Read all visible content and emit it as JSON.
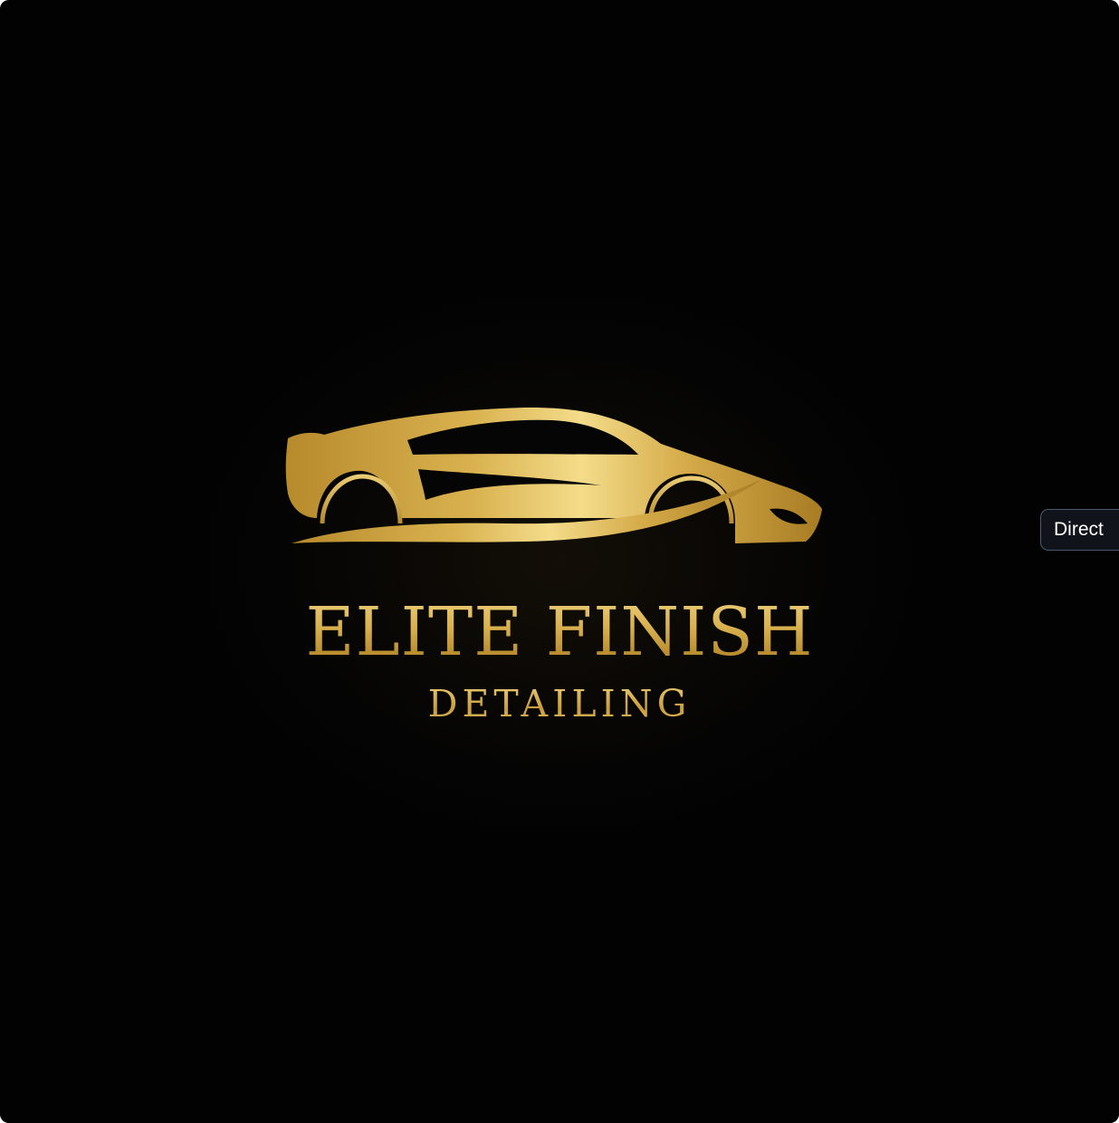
{
  "logo": {
    "brand_name": "ELITE FINISH",
    "brand_sub": "DETAILING",
    "icon": "sports-car-icon",
    "colors": {
      "background": "#050505",
      "gold_light": "#f2d685",
      "gold": "#d8b04d",
      "gold_dark": "#b98d2f"
    }
  },
  "overlay": {
    "button_label": "Direct"
  }
}
